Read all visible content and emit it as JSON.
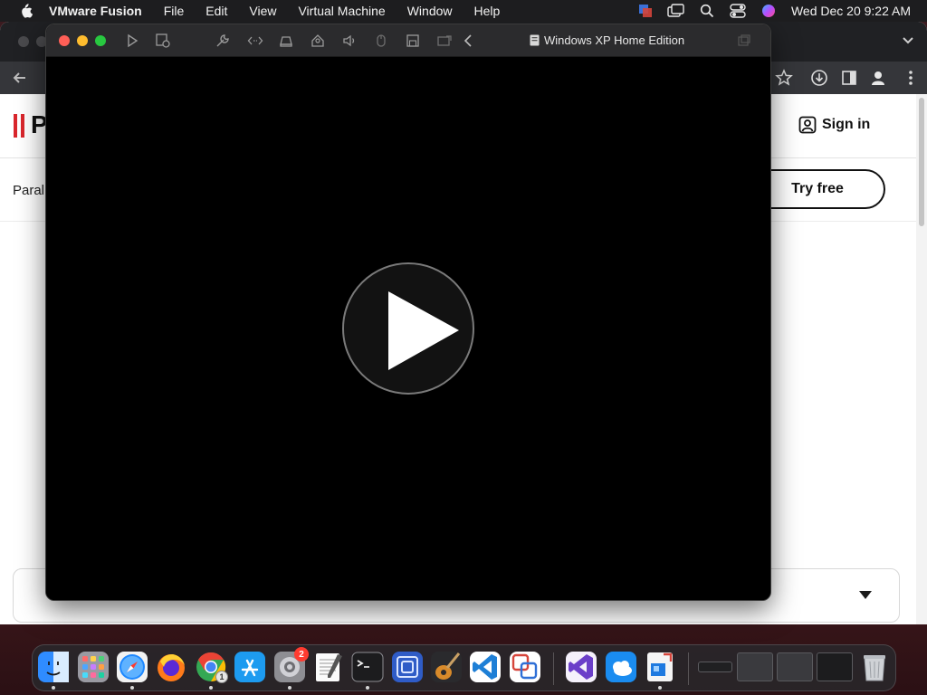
{
  "menubar": {
    "app_name": "VMware Fusion",
    "menus": [
      "File",
      "Edit",
      "View",
      "Virtual Machine",
      "Window",
      "Help"
    ],
    "status_icons": [
      "vmware-status-icon",
      "screen-mirroring-icon",
      "spotlight-search-icon",
      "control-center-icon",
      "siri-icon"
    ],
    "clock": "Wed Dec 20  9:22 AM"
  },
  "browser": {
    "toolbar_icons": [
      "back-arrow-icon",
      "bookmark-star-icon",
      "download-icon",
      "sidebar-icon",
      "profile-icon"
    ],
    "site": {
      "logo_letter": "P",
      "sign_in": "Sign in",
      "nav_text": "Paral",
      "try_free": "Try free",
      "brand_color": "#d9262c"
    }
  },
  "vm_window": {
    "title": "Windows XP Home Edition",
    "toolbar_icons": [
      "start-vm-icon",
      "snapshot-icon",
      "settings-wrench-icon",
      "code-brackets-icon",
      "printer-icon",
      "user-share-icon",
      "sound-icon",
      "mouse-icon",
      "disk-save-icon",
      "camera-icon",
      "chevron-left-icon"
    ],
    "play_button_icon": "play-icon"
  },
  "dock": {
    "apps": [
      {
        "name": "finder-icon",
        "running": true
      },
      {
        "name": "launchpad-icon",
        "running": false
      },
      {
        "name": "safari-icon",
        "running": true
      },
      {
        "name": "firefox-icon",
        "running": false
      },
      {
        "name": "chrome-icon",
        "running": true,
        "badge": "1"
      },
      {
        "name": "app-store-icon",
        "running": false
      },
      {
        "name": "system-settings-icon",
        "running": true,
        "badge": "2"
      },
      {
        "name": "textedit-icon",
        "running": false
      },
      {
        "name": "terminal-icon",
        "running": true
      },
      {
        "name": "vmware-fusion-icon",
        "running": false
      },
      {
        "name": "garageband-icon",
        "running": false
      },
      {
        "name": "vscode-icon",
        "running": false
      },
      {
        "name": "remote-desktop-icon",
        "running": false
      },
      {
        "name": "visual-studio-icon",
        "running": false
      },
      {
        "name": "weather-icon",
        "running": false
      },
      {
        "name": "parallels-icon",
        "running": true
      }
    ],
    "minimized_windows": [
      "minimized-window-1",
      "minimized-window-2",
      "minimized-window-3",
      "minimized-window-4"
    ],
    "trash": "trash-icon"
  }
}
